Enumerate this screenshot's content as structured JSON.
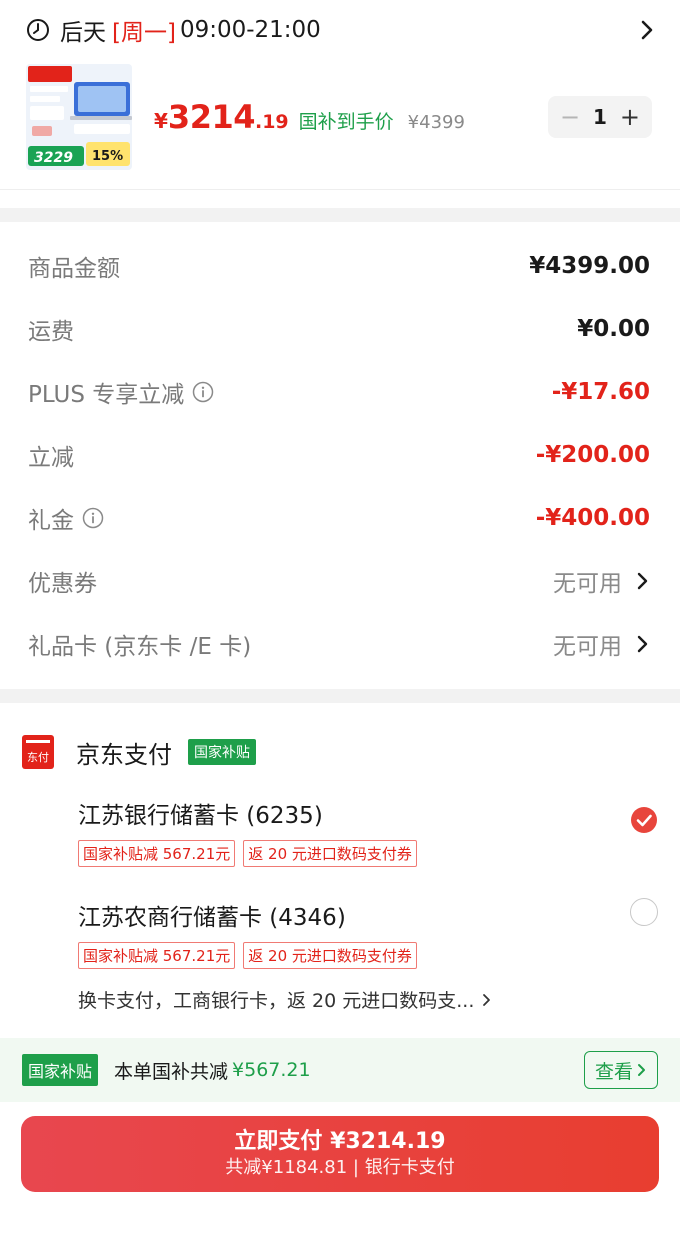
{
  "delivery": {
    "day": "后天",
    "weekday": "[周一]",
    "time": "09:00-21:00"
  },
  "product": {
    "thumb_price_badge": "3229",
    "thumb_discount": "15%",
    "currency": "¥",
    "price_int": "3214",
    "price_dec": ".19",
    "price_note": "国补到手价",
    "original_price": "¥4399",
    "quantity": "1"
  },
  "fees": [
    {
      "label": "商品金额",
      "value": "¥4399.00"
    },
    {
      "label": "运费",
      "value": "¥0.00"
    },
    {
      "label": "PLUS 专享立减",
      "value": "-¥17.60"
    },
    {
      "label": "立减",
      "value": "-¥200.00"
    },
    {
      "label": "礼金",
      "value": "-¥400.00"
    },
    {
      "label": "优惠券",
      "value": "无可用"
    },
    {
      "label": "礼品卡 (京东卡 /E 卡)",
      "value": "无可用"
    }
  ],
  "jd_pay": {
    "logo_text": "东付",
    "title": "京东支付",
    "badge": "国家补贴",
    "cards": [
      {
        "name": "江苏银行储蓄卡 (6235)",
        "tag1": "国家补贴减 567.21元",
        "tag2": "返 20 元进口数码支付券",
        "selected": true
      },
      {
        "name": "江苏农商行储蓄卡 (4346)",
        "tag1": "国家补贴减 567.21元",
        "tag2": "返 20 元进口数码支付券",
        "selected": false
      }
    ],
    "switch_text": "换卡支付，工商银行卡，返 20 元进口数码支..."
  },
  "subsidy_bar": {
    "badge": "国家补贴",
    "text": "本单国补共减",
    "amount": "¥567.21",
    "view_label": "查看"
  },
  "pay_button": {
    "main": "立即支付 ¥3214.19",
    "sub": "共减¥1184.81 | 银行卡支付"
  },
  "colors": {
    "red": "#e2231a",
    "green": "#1e9f4a",
    "gray": "#7a7a7a"
  }
}
